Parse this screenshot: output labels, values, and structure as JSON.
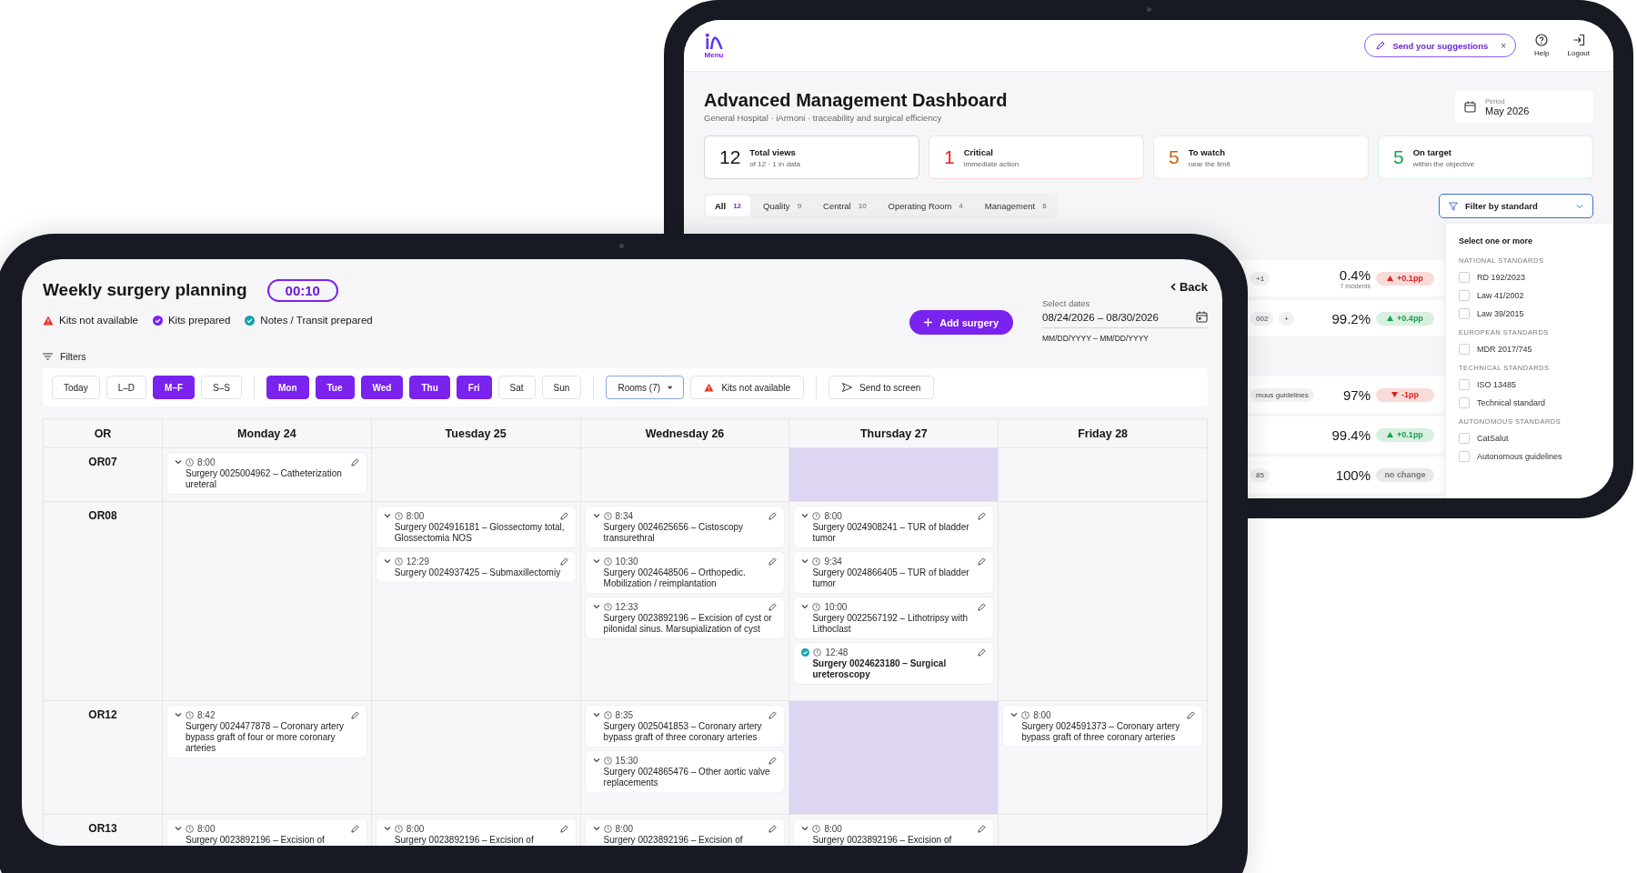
{
  "dashboard": {
    "menu_label": "Menu",
    "suggestion": "Send your suggestions",
    "suggestion_close": "×",
    "help": "Help",
    "logout": "Logout",
    "title": "Advanced Management Dashboard",
    "subtitle": "General Hospital · iArmoni · traceability and surgical efficiency",
    "period_label": "Period",
    "period": "May 2026",
    "stats": [
      {
        "value": "12",
        "label": "Total views",
        "note": "of 12 · 1 in data",
        "color": "#15151a"
      },
      {
        "value": "1",
        "label": "Critical",
        "note": "immediate action",
        "color": "#e0241b"
      },
      {
        "value": "5",
        "label": "To watch",
        "note": "near the limit",
        "color": "#c8650c"
      },
      {
        "value": "5",
        "label": "On target",
        "note": "within the objective",
        "color": "#1aa34a"
      }
    ],
    "tabs": [
      {
        "label": "All",
        "count": "12",
        "selected": true
      },
      {
        "label": "Quality",
        "count": "9",
        "selected": false
      },
      {
        "label": "Central",
        "count": "10",
        "selected": false
      },
      {
        "label": "Operating Room",
        "count": "4",
        "selected": false
      },
      {
        "label": "Management",
        "count": "6",
        "selected": false
      }
    ],
    "filter_button": "Filter by standard",
    "row_groups": [
      {
        "rows": [
          {
            "chips": [
              "+1"
            ],
            "value": "0.4%",
            "note": "7 incidents",
            "delta": "+0.1pp",
            "kind": "up",
            "color": "#d9231b"
          },
          {
            "chips": [
              "002",
              "+"
            ],
            "value": "99.2%",
            "delta": "+0.4pp",
            "kind": "up",
            "color": "#18a04a"
          }
        ]
      },
      {
        "rows": [
          {
            "chips": [
              "mous guidelines"
            ],
            "value": "97%",
            "delta": "-1pp",
            "kind": "down",
            "color": "#d9231b"
          },
          {
            "value": "99.4%",
            "delta": "+0.1pp",
            "kind": "up",
            "color": "#18a04a"
          },
          {
            "chips": [
              "85"
            ],
            "value": "100%",
            "delta": "no change",
            "kind": "flat",
            "color": "#777777"
          }
        ]
      }
    ],
    "dropdown": {
      "heading": "Select one or more",
      "groups": [
        {
          "title": "NATIONAL STANDARDS",
          "options": [
            {
              "label": "RD 192/2023",
              "checked": false
            },
            {
              "label": "Law 41/2002",
              "checked": false
            },
            {
              "label": "Law 39/2015",
              "checked": false
            }
          ]
        },
        {
          "title": "EUROPEAN STANDARDS",
          "options": [
            {
              "label": "MDR 2017/745",
              "checked": false
            }
          ]
        },
        {
          "title": "TECHNICAL STANDARDS",
          "options": [
            {
              "label": "ISO 13485",
              "checked": false
            },
            {
              "label": "Technical standard",
              "checked": false
            }
          ]
        },
        {
          "title": "AUTONOMOUS STANDARDS",
          "options": [
            {
              "label": "CatSalut",
              "checked": false
            },
            {
              "label": "Autonomous guidelines",
              "checked": false
            }
          ]
        }
      ]
    }
  },
  "planning": {
    "title": "Weekly surgery planning",
    "timer": "00:10",
    "back": "Back",
    "legend": [
      {
        "kind": "alert",
        "label": "Kits not available"
      },
      {
        "kind": "kits",
        "label": "Kits prepared"
      },
      {
        "kind": "notes",
        "label": "Notes / Transit prepared"
      }
    ],
    "add_button": "Add surgery",
    "dates_label": "Select dates",
    "dates": "08/24/2026 – 08/30/2026",
    "date_format": "MM/DD/YYYY – MM/DD/YYYY",
    "filters_label": "Filters",
    "range_buttons": [
      {
        "label": "Today",
        "selected": false
      },
      {
        "label": "L–D",
        "selected": false
      },
      {
        "label": "M–F",
        "selected": true
      },
      {
        "label": "S–S",
        "selected": false
      }
    ],
    "day_buttons": [
      {
        "label": "Mon",
        "selected": true
      },
      {
        "label": "Tue",
        "selected": true
      },
      {
        "label": "Wed",
        "selected": true
      },
      {
        "label": "Thu",
        "selected": true
      },
      {
        "label": "Fri",
        "selected": true
      },
      {
        "label": "Sat",
        "selected": false
      },
      {
        "label": "Sun",
        "selected": false
      }
    ],
    "rooms_dropdown": "Rooms (7)",
    "kits_button": "Kits not available",
    "send_button": "Send to screen",
    "columns": [
      "OR",
      "Monday 24",
      "Tuesday 25",
      "Wednesday 26",
      "Thursday 27",
      "Friday 28"
    ],
    "rows": [
      {
        "cells": [
          {
            "kind": "room",
            "text": "OR07"
          },
          {
            "kind": "day",
            "shaded": false,
            "surgeries": [
              {
                "time": "8:00",
                "title": "Surgery 0025004962 – Catheterization ureteral",
                "notes_prepared": false
              }
            ]
          },
          {
            "kind": "day",
            "shaded": false
          },
          {
            "kind": "day",
            "shaded": false
          },
          {
            "kind": "day",
            "shaded": true
          },
          {
            "kind": "day",
            "shaded": false
          }
        ]
      },
      {
        "cells": [
          {
            "kind": "room",
            "text": "OR08"
          },
          {
            "kind": "day",
            "shaded": false
          },
          {
            "kind": "day",
            "shaded": false,
            "surgeries": [
              {
                "time": "8:00",
                "title": "Surgery 0024916181 – Glossectomy total, Glossectomia NOS",
                "notes_prepared": false
              },
              {
                "time": "12:29",
                "title": "Surgery 0024937425 – Submaxillectomiy",
                "notes_prepared": false
              }
            ]
          },
          {
            "kind": "day",
            "shaded": false,
            "surgeries": [
              {
                "time": "8:34",
                "title": "Surgery 0024625656 – Cistoscopy transurethral",
                "notes_prepared": false
              },
              {
                "time": "10:30",
                "title": "Surgery 0024648506 – Orthopedic. Mobilization / reimplantation",
                "notes_prepared": false
              },
              {
                "time": "12:33",
                "title": "Surgery 0023892196 – Excision of cyst or pilonidal sinus. Marsupialization of cyst",
                "notes_prepared": false
              }
            ]
          },
          {
            "kind": "day",
            "shaded": false,
            "surgeries": [
              {
                "time": "8:00",
                "title": "Surgery 0024908241 – TUR of bladder tumor",
                "notes_prepared": false
              },
              {
                "time": "9:34",
                "title": "Surgery 0024866405 – TUR of bladder tumor",
                "notes_prepared": false
              },
              {
                "time": "10:00",
                "title": "Surgery 0022567192 – Lithotripsy with Lithoclast",
                "notes_prepared": false
              },
              {
                "time": "12:48",
                "title": "Surgery 0024623180 – Surgical ureteroscopy",
                "notes_prepared": true
              }
            ]
          },
          {
            "kind": "day",
            "shaded": false
          }
        ]
      },
      {
        "cells": [
          {
            "kind": "room",
            "text": "OR12"
          },
          {
            "kind": "day",
            "shaded": false,
            "surgeries": [
              {
                "time": "8:42",
                "title": "Surgery 0024477878 – Coronary artery bypass graft of four or more coronary arteries",
                "notes_prepared": false
              }
            ]
          },
          {
            "kind": "day",
            "shaded": false
          },
          {
            "kind": "day",
            "shaded": false,
            "surgeries": [
              {
                "time": "8:35",
                "title": "Surgery 0025041853 – Coronary artery bypass graft of three coronary arteries",
                "notes_prepared": false
              },
              {
                "time": "15:30",
                "title": "Surgery 0024865476 – Other aortic valve replacements",
                "notes_prepared": false
              }
            ]
          },
          {
            "kind": "day",
            "shaded": true
          },
          {
            "kind": "day",
            "shaded": false,
            "surgeries": [
              {
                "time": "8:00",
                "title": "Surgery 0024591373 – Coronary artery bypass graft of three coronary arteries",
                "notes_prepared": false
              }
            ]
          }
        ]
      },
      {
        "cells": [
          {
            "kind": "room",
            "text": "OR13"
          },
          {
            "kind": "day",
            "shaded": false,
            "surgeries": [
              {
                "time": "8:00",
                "title": "Surgery 0023892196 – Excision of",
                "notes_prepared": false
              }
            ]
          },
          {
            "kind": "day",
            "shaded": false,
            "surgeries": [
              {
                "time": "8:00",
                "title": "Surgery 0023892196 – Excision of",
                "notes_prepared": false
              }
            ]
          },
          {
            "kind": "day",
            "shaded": false,
            "surgeries": [
              {
                "time": "8:00",
                "title": "Surgery 0023892196 – Excision of",
                "notes_prepared": false
              }
            ]
          },
          {
            "kind": "day",
            "shaded": false,
            "surgeries": [
              {
                "time": "8:00",
                "title": "Surgery 0023892196 – Excision of",
                "notes_prepared": false
              }
            ]
          },
          {
            "kind": "day",
            "shaded": false
          }
        ]
      }
    ]
  }
}
